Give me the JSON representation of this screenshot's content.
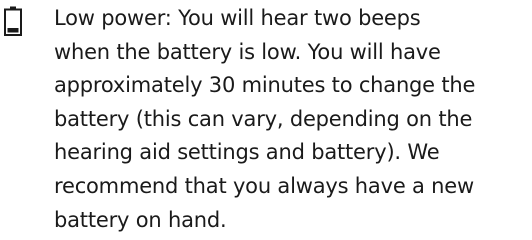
{
  "note": {
    "icon": "battery-low-icon",
    "lines": [
      "Low power: You will hear two beeps",
      "when the battery is low. You will have",
      "approximately 30 minutes to change the",
      "battery (this can vary, depending on the",
      "hearing aid settings and battery). We",
      "recommend that you always have a new",
      "battery on hand."
    ]
  }
}
